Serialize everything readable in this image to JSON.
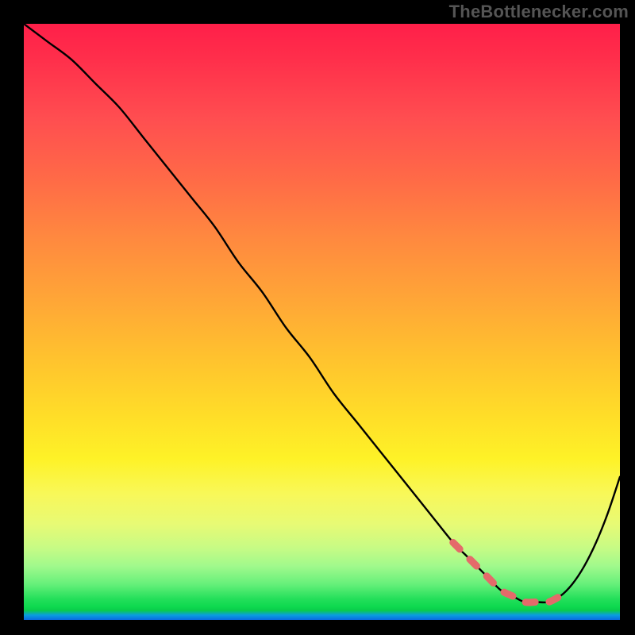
{
  "watermark": "TheBottlenecker.com",
  "chart_data": {
    "type": "line",
    "title": "",
    "xlabel": "",
    "ylabel": "",
    "xlim": [
      0,
      100
    ],
    "ylim": [
      0,
      100
    ],
    "grid": false,
    "legend": false,
    "series": [
      {
        "name": "bottleneck-curve",
        "x": [
          0,
          4,
          8,
          12,
          16,
          20,
          24,
          28,
          32,
          36,
          40,
          44,
          48,
          52,
          56,
          60,
          64,
          68,
          72,
          74,
          76,
          78,
          80,
          82,
          84,
          86,
          88,
          90,
          92,
          94,
          96,
          98,
          100
        ],
        "values": [
          100,
          97,
          94,
          90,
          86,
          81,
          76,
          71,
          66,
          60,
          55,
          49,
          44,
          38,
          33,
          28,
          23,
          18,
          13,
          11,
          9,
          7,
          5,
          4,
          3,
          3,
          3,
          4,
          6,
          9,
          13,
          18,
          24
        ]
      }
    ],
    "highlight": {
      "name": "optimal-range",
      "x_start": 70,
      "x_end": 90,
      "style": "dashed"
    },
    "gradient_stops": [
      {
        "pos": 0.0,
        "color": "#ff1f49"
      },
      {
        "pos": 0.36,
        "color": "#ff893f"
      },
      {
        "pos": 0.66,
        "color": "#ffde28"
      },
      {
        "pos": 0.88,
        "color": "#c6fb85"
      },
      {
        "pos": 0.97,
        "color": "#0ed94f"
      },
      {
        "pos": 1.0,
        "color": "#0a6ae0"
      }
    ]
  }
}
